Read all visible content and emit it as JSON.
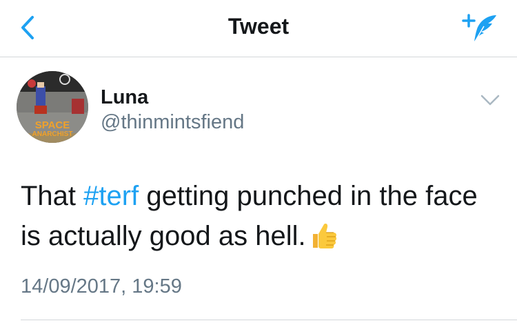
{
  "nav": {
    "title": "Tweet",
    "back_icon": "chevron-left-icon",
    "compose_icon": "compose-tweet-icon",
    "accent": "#1da1f2"
  },
  "tweet": {
    "author": {
      "name": "Luna",
      "handle": "@thinmintsfiend",
      "avatar_text": [
        "SPACE",
        "ANARCHIST"
      ]
    },
    "text": {
      "before": "That ",
      "hashtag": "#terf",
      "after": " getting punched in the face is actually good as hell.",
      "emoji": "thumbs-up"
    },
    "timestamp": "14/09/2017, 19:59",
    "menu_icon": "chevron-down-icon"
  },
  "colors": {
    "text": "#14171a",
    "secondary": "#657786",
    "link": "#1da1f2",
    "divider": "#d3d6d9"
  }
}
